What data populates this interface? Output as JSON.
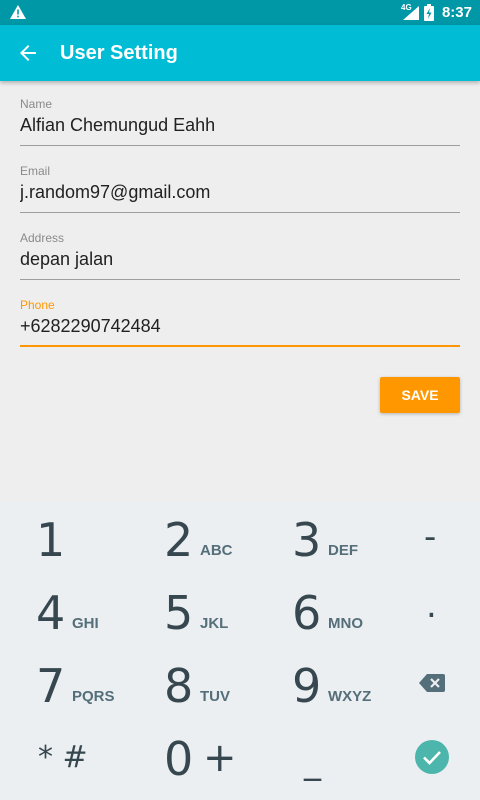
{
  "status_bar": {
    "network": "4G",
    "time": "8:37",
    "icons": [
      "warning-icon",
      "signal-icon",
      "battery-icon"
    ]
  },
  "app_bar": {
    "title": "User Setting",
    "back_icon": "arrow-left-icon"
  },
  "form": {
    "name": {
      "label": "Name",
      "value": "Alfian Chemungud Eahh"
    },
    "email": {
      "label": "Email",
      "value": "j.random97@gmail.com"
    },
    "address": {
      "label": "Address",
      "value": "depan jalan"
    },
    "phone": {
      "label": "Phone",
      "value": "+6282290742484"
    },
    "save_label": "SAVE"
  },
  "keypad": {
    "k1": {
      "digit": "1",
      "letters": ""
    },
    "k2": {
      "digit": "2",
      "letters": "ABC"
    },
    "k3": {
      "digit": "3",
      "letters": "DEF"
    },
    "k4": {
      "digit": "4",
      "letters": "GHI"
    },
    "k5": {
      "digit": "5",
      "letters": "JKL"
    },
    "k6": {
      "digit": "6",
      "letters": "MNO"
    },
    "k7": {
      "digit": "7",
      "letters": "PQRS"
    },
    "k8": {
      "digit": "8",
      "letters": "TUV"
    },
    "k9": {
      "digit": "9",
      "letters": "WXYZ"
    },
    "k0": {
      "digit": "0",
      "letters": "+"
    },
    "minus": "-",
    "dot": ".",
    "star_hash": "* #",
    "space": "_",
    "colors": {
      "accent": "#ff9800",
      "appbar": "#00bcd4",
      "statusbar": "#0097a7",
      "done": "#4db6ac"
    }
  }
}
